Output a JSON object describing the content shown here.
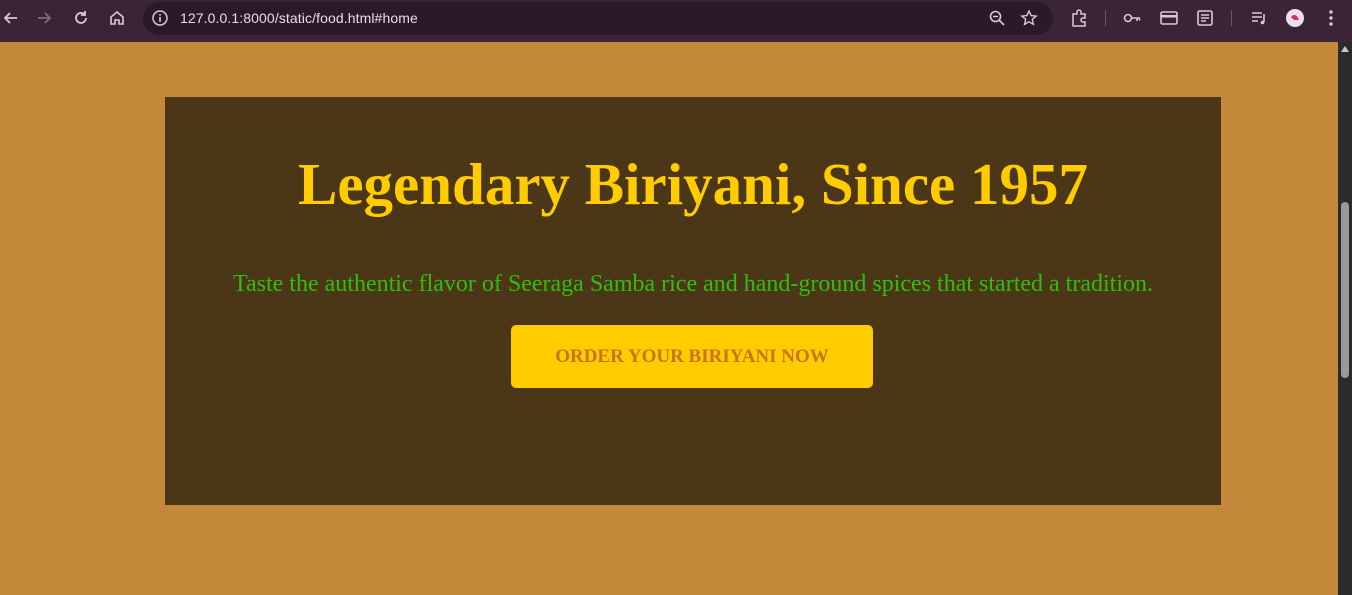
{
  "browser": {
    "url": "127.0.0.1:8000/static/food.html#home",
    "icons": [
      "back-arrow-icon",
      "forward-arrow-icon",
      "reload-icon",
      "home-icon",
      "site-info-icon",
      "zoom-icon",
      "bookmark-star-icon",
      "extensions-icon",
      "password-key-icon",
      "payment-card-icon",
      "reading-list-icon",
      "media-controls-icon",
      "profile-avatar-icon",
      "menu-dots-icon"
    ]
  },
  "hero": {
    "title": "Legendary Biriyani, Since 1957",
    "subtitle": "Taste the authentic flavor of Seeraga Samba rice and hand-ground spices that started a tradition.",
    "cta_label": "ORDER YOUR BIRIYANI NOW"
  },
  "colors": {
    "page_bg": "#c4883a",
    "hero_bg": "#4b3618",
    "title": "#ffcc00",
    "subtitle": "#2fbe10",
    "button_bg": "#ffcc00",
    "button_text": "#c8741e",
    "browser_chrome": "#3a2436"
  }
}
